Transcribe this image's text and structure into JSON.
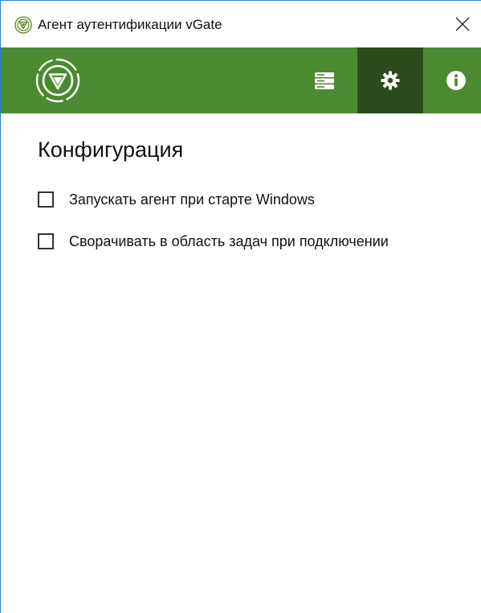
{
  "window": {
    "title": "Агент аутентификации vGate"
  },
  "header": {
    "active_tab": "settings"
  },
  "content": {
    "title": "Конфигурация",
    "options": [
      {
        "label": "Запускать агент при старте Windows",
        "checked": false
      },
      {
        "label": "Сворачивать в область задач при подключении",
        "checked": false
      }
    ]
  },
  "colors": {
    "header_bg": "#4b8a30",
    "header_active_bg": "#2b4d1b",
    "window_border": "#2b7fd8"
  },
  "icons": {
    "app": "vgate-shield-icon",
    "close": "close-icon",
    "servers": "server-icon",
    "settings": "gear-icon",
    "info": "info-icon"
  }
}
